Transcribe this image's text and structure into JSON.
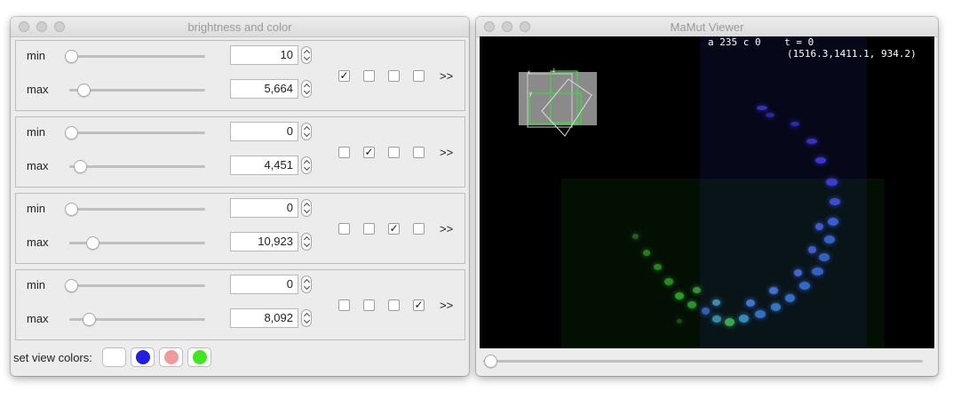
{
  "brightness_window": {
    "title": "brightness and color",
    "channels": [
      {
        "min_label": "min",
        "min_value": "10",
        "max_label": "max",
        "max_value": "5,664",
        "checked": [
          true,
          false,
          false,
          false
        ],
        "more": ">>"
      },
      {
        "min_label": "min",
        "min_value": "0",
        "max_label": "max",
        "max_value": "4,451",
        "checked": [
          false,
          true,
          false,
          false
        ],
        "more": ">>"
      },
      {
        "min_label": "min",
        "min_value": "0",
        "max_label": "max",
        "max_value": "10,923",
        "checked": [
          false,
          false,
          true,
          false
        ],
        "more": ">>"
      },
      {
        "min_label": "min",
        "min_value": "0",
        "max_label": "max",
        "max_value": "8,092",
        "checked": [
          false,
          false,
          false,
          true
        ],
        "more": ">>"
      }
    ],
    "set_colors_label": "set view colors:",
    "view_colors": [
      "#ffffff",
      "#1f1fe6",
      "#f29a9a",
      "#3ee81c"
    ]
  },
  "viewer_window": {
    "title": "MaMut Viewer",
    "status_line": "a 235 c 0    t = 0",
    "coordinates": "(1516.3,1411.1, 934.2)"
  }
}
